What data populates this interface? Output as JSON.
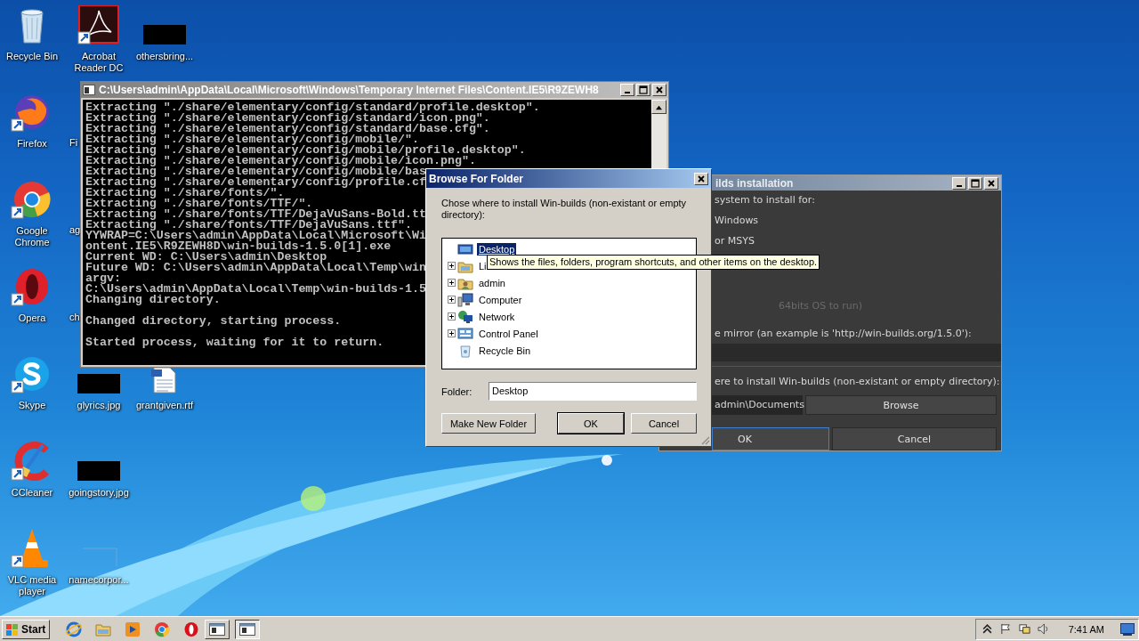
{
  "desktop": {
    "icons": [
      {
        "label": "Recycle Bin",
        "kind": "recycle",
        "shortcut": false
      },
      {
        "label": "Acrobat Reader DC",
        "kind": "acrobat",
        "shortcut": true
      },
      {
        "label": "othersbring...",
        "kind": "thumb",
        "shortcut": false
      },
      {
        "label": "Firefox",
        "kind": "firefox",
        "shortcut": true
      },
      {
        "label": "Fi",
        "kind": "partial",
        "shortcut": false
      },
      {
        "label": "Google Chrome",
        "kind": "chrome",
        "shortcut": true
      },
      {
        "label": "ag",
        "kind": "partial",
        "shortcut": false
      },
      {
        "label": "Opera",
        "kind": "opera",
        "shortcut": true
      },
      {
        "label": "ch",
        "kind": "partial",
        "shortcut": false
      },
      {
        "label": "Skype",
        "kind": "skype",
        "shortcut": true
      },
      {
        "label": "glyrics.jpg",
        "kind": "thumb",
        "shortcut": false
      },
      {
        "label": "grantgiven.rtf",
        "kind": "rtf",
        "shortcut": false
      },
      {
        "label": "CCleaner",
        "kind": "ccleaner",
        "shortcut": true
      },
      {
        "label": "goingstory.jpg",
        "kind": "thumb",
        "shortcut": false
      },
      {
        "label": "VLC media player",
        "kind": "vlc",
        "shortcut": true
      },
      {
        "label": "namecorpor...",
        "kind": "blank",
        "shortcut": false
      }
    ]
  },
  "console_window": {
    "title": "C:\\Users\\admin\\AppData\\Local\\Microsoft\\Windows\\Temporary Internet Files\\Content.IE5\\R9ZEWH8",
    "blocks": [
      [
        "Extracting \"./share/elementary/config/standard/profile.desktop\".",
        "Extracting \"./share/elementary/config/standard/icon.png\".",
        "Extracting \"./share/elementary/config/standard/base.cfg\".",
        "Extracting \"./share/elementary/config/mobile/\".",
        "Extracting \"./share/elementary/config/mobile/profile.desktop\".",
        "Extracting \"./share/elementary/config/mobile/icon.png\".",
        "Extracting \"./share/elementary/config/mobile/bas",
        "Extracting \"./share/elementary/config/profile.cf",
        "Extracting \"./share/fonts/\".",
        "Extracting \"./share/fonts/TTF/\".",
        "Extracting \"./share/fonts/TTF/DejaVuSans-Bold.tt",
        "Extracting \"./share/fonts/TTF/DejaVuSans.ttf\".",
        "YYWRAP=C:\\Users\\admin\\AppData\\Local\\Microsoft\\Wi",
        "ontent.IE5\\R9ZEWH8D\\win-builds-1.5.0[1].exe",
        "Current WD: C:\\Users\\admin\\Desktop",
        "Future WD: C:\\Users\\admin\\AppData\\Local\\Temp\\win",
        "argv:",
        "C:\\Users\\admin\\AppData\\Local\\Temp\\win-builds-1.5",
        "Changing directory."
      ],
      [
        "Changed directory, starting process."
      ],
      [
        "Started process, waiting for it to return."
      ]
    ]
  },
  "installer_window": {
    "title": "ilds installation",
    "system_prompt": "system to install for:",
    "options": [
      {
        "label": "Windows"
      },
      {
        "label": "or MSYS"
      }
    ],
    "arch_note": {
      "text": "64bits OS to run)",
      "disabled": true
    },
    "mirror_prompt": "e mirror (an example is 'http://win-builds.org/1.5.0'):",
    "directory_prompt": "ere to install Win-builds (non-existant or empty directory):",
    "directory_field": {
      "value": "admin\\Documents"
    },
    "browse_button": "Browse",
    "buttons": [
      {
        "label": "OK",
        "focused": true
      },
      {
        "label": "Cancel",
        "focused": false
      }
    ]
  },
  "browse_dialog": {
    "title": "Browse For Folder",
    "prompt": "Chose where to install Win-builds (non-existant or empty directory):",
    "tree": [
      {
        "label": "Desktop",
        "kind": "desktop",
        "has_children": false,
        "selected": true
      },
      {
        "label": "Li",
        "kind": "libraries",
        "has_children": true,
        "selected": false
      },
      {
        "label": "admin",
        "kind": "user",
        "has_children": true,
        "selected": false
      },
      {
        "label": "Computer",
        "kind": "computer",
        "has_children": true,
        "selected": false
      },
      {
        "label": "Network",
        "kind": "network",
        "has_children": true,
        "selected": false
      },
      {
        "label": "Control Panel",
        "kind": "control",
        "has_children": true,
        "selected": false
      },
      {
        "label": "Recycle Bin",
        "kind": "recycle",
        "has_children": false,
        "selected": false
      }
    ],
    "folder_label": "Folder:",
    "folder_value": "Desktop",
    "buttons": [
      {
        "label": "Make New Folder",
        "default": false
      },
      {
        "label": "OK",
        "default": true
      },
      {
        "label": "Cancel",
        "default": false
      }
    ]
  },
  "tooltip": {
    "text": "Shows the files, folders, program shortcuts, and other items on the desktop."
  },
  "taskbar": {
    "start_label": "Start",
    "apps": [
      {
        "kind": "ie",
        "selected": false
      },
      {
        "kind": "explorer",
        "selected": false
      },
      {
        "kind": "media",
        "selected": false
      },
      {
        "kind": "chrome",
        "selected": false
      },
      {
        "kind": "opera",
        "selected": false
      },
      {
        "kind": "window",
        "selected": false
      },
      {
        "kind": "window",
        "selected": true
      }
    ],
    "clock": "7:41 AM"
  }
}
